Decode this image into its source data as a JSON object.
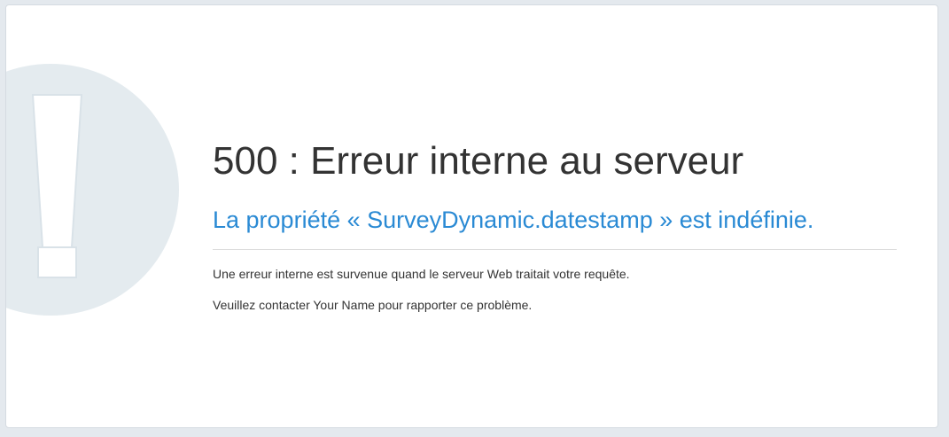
{
  "error": {
    "title": "500 : Erreur interne au serveur",
    "subtitle": "La propriété « SurveyDynamic.datestamp » est indéfinie.",
    "message_1": "Une erreur interne est survenue quand le serveur Web traitait votre requête.",
    "message_2": "Veuillez contacter Your Name pour rapporter ce problème."
  },
  "icons": {
    "background": "exclamation-circle-icon"
  },
  "colors": {
    "page_background": "#e4e9ee",
    "panel_background": "#ffffff",
    "title": "#333333",
    "subtitle": "#2a8ad4",
    "icon_circle": "#e4ebef",
    "icon_mark": "#ffffff"
  }
}
